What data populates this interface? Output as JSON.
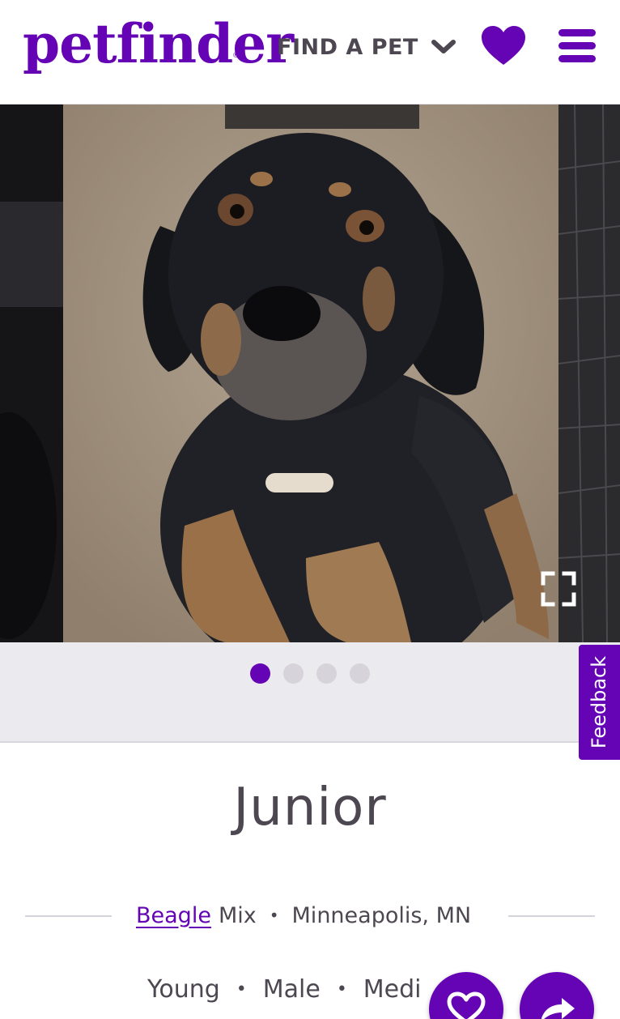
{
  "header": {
    "logo_text": "petfinder",
    "logo_reg": "®",
    "nav_label": "FIND A PET",
    "brand_color": "#6504b5",
    "icons": [
      "chevron-down-icon",
      "heart-icon",
      "menu-icon"
    ]
  },
  "gallery": {
    "current_slide": 1,
    "total_slides": 4,
    "icons": [
      "expand-icon"
    ]
  },
  "feedback": {
    "label": "Feedback"
  },
  "pet": {
    "name": "Junior",
    "breed_link": "Beagle",
    "breed_suffix": "Mix",
    "location": "Minneapolis, MN",
    "age": "Young",
    "sex": "Male",
    "size_partial": "Medi",
    "separator": "•"
  },
  "actions": {
    "icons": [
      "heart-outline-icon",
      "share-arrow-icon"
    ]
  }
}
